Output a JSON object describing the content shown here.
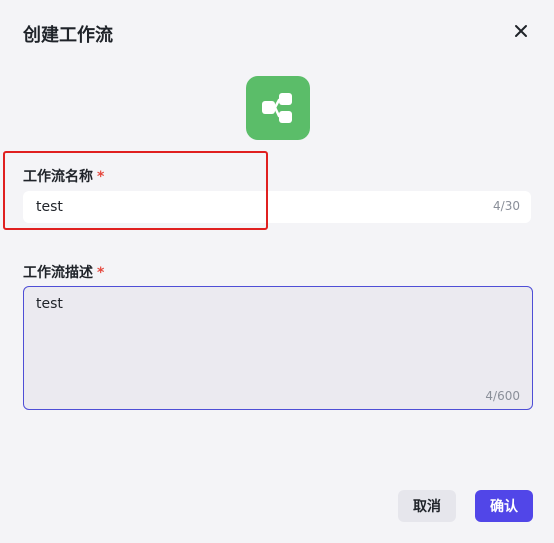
{
  "dialog": {
    "title": "创建工作流",
    "close_icon": "close-icon"
  },
  "app_icon": {
    "icon": "workflow-icon",
    "background": "#5bbd69"
  },
  "name_field": {
    "label": "工作流名称",
    "required_mark": "*",
    "value": "test",
    "counter": "4/30"
  },
  "description_field": {
    "label": "工作流描述",
    "required_mark": "*",
    "value": "test",
    "counter": "4/600"
  },
  "buttons": {
    "cancel": "取消",
    "confirm": "确认"
  },
  "colors": {
    "accent": "#5146e8",
    "required": "#e5483e",
    "highlight": "#e02020"
  }
}
